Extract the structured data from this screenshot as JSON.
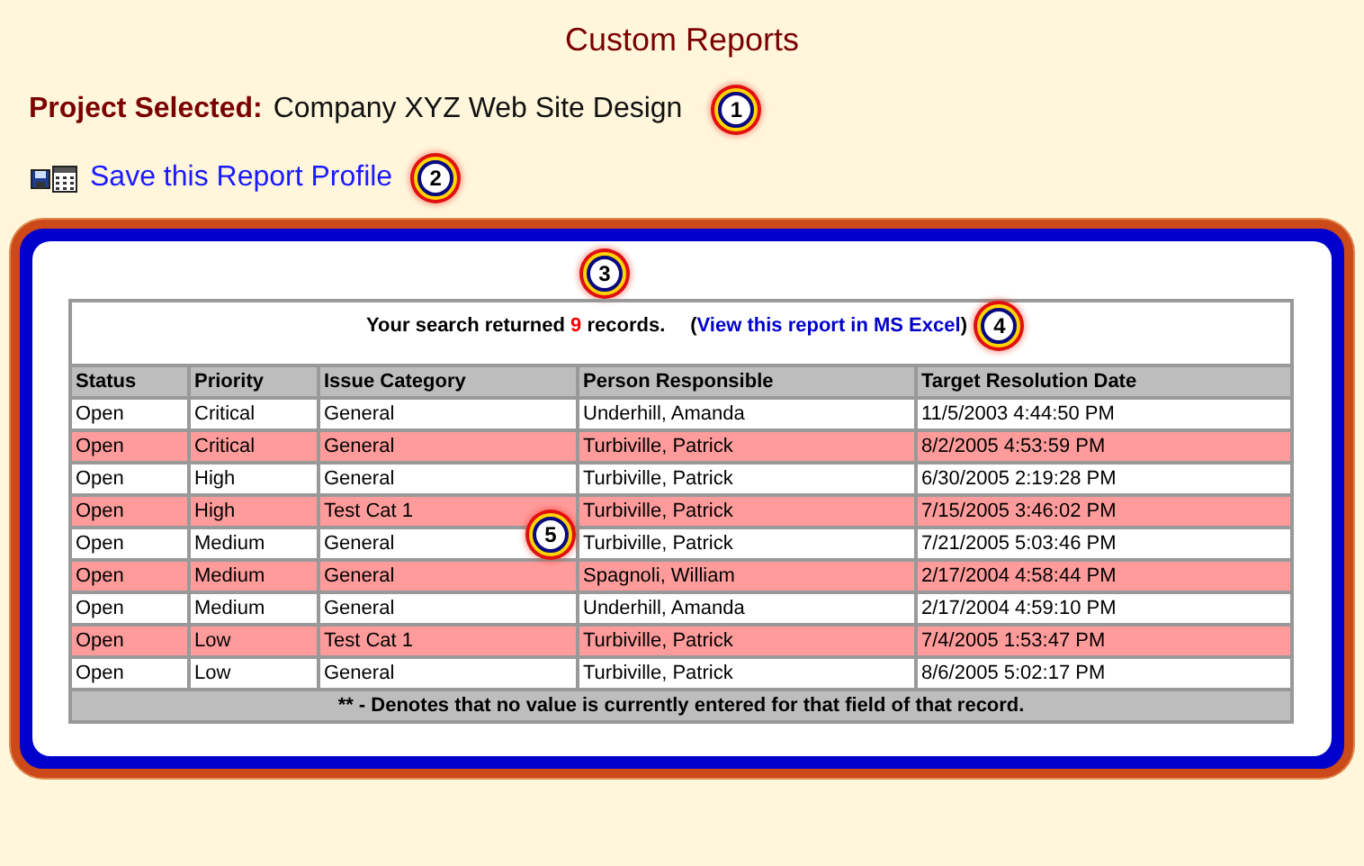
{
  "title": "Custom Reports",
  "project": {
    "label": "Project Selected:",
    "value": "Company XYZ Web Site Design",
    "callout": "1"
  },
  "save_link": {
    "text": "Save this Report Profile",
    "callout": "2"
  },
  "report": {
    "callout_above": "3",
    "summary": {
      "prefix": "Your search returned",
      "count": "9",
      "suffix": "records.",
      "link_open": "(",
      "link": "View this report in MS Excel",
      "link_close": ")",
      "callout": "4"
    },
    "table_callout": "5",
    "columns": [
      "Status",
      "Priority",
      "Issue Category",
      "Person Responsible",
      "Target Resolution Date"
    ],
    "rows": [
      {
        "cells": [
          "Open",
          "Critical",
          "General",
          "Underhill, Amanda",
          "11/5/2003 4:44:50 PM"
        ],
        "highlighted": false
      },
      {
        "cells": [
          "Open",
          "Critical",
          "General",
          "Turbiville, Patrick",
          "8/2/2005 4:53:59 PM"
        ],
        "highlighted": true
      },
      {
        "cells": [
          "Open",
          "High",
          "General",
          "Turbiville, Patrick",
          "6/30/2005 2:19:28 PM"
        ],
        "highlighted": false
      },
      {
        "cells": [
          "Open",
          "High",
          "Test Cat 1",
          "Turbiville, Patrick",
          "7/15/2005 3:46:02 PM"
        ],
        "highlighted": true
      },
      {
        "cells": [
          "Open",
          "Medium",
          "General",
          "Turbiville, Patrick",
          "7/21/2005 5:03:46 PM"
        ],
        "highlighted": false
      },
      {
        "cells": [
          "Open",
          "Medium",
          "General",
          "Spagnoli, William",
          "2/17/2004 4:58:44 PM"
        ],
        "highlighted": true
      },
      {
        "cells": [
          "Open",
          "Medium",
          "General",
          "Underhill, Amanda",
          "2/17/2004 4:59:10 PM"
        ],
        "highlighted": false
      },
      {
        "cells": [
          "Open",
          "Low",
          "Test Cat 1",
          "Turbiville, Patrick",
          "7/4/2005 1:53:47 PM"
        ],
        "highlighted": true
      },
      {
        "cells": [
          "Open",
          "Low",
          "General",
          "Turbiville, Patrick",
          "8/6/2005 5:02:17 PM"
        ],
        "highlighted": false
      }
    ],
    "footnote": "** - Denotes that no value is currently entered for that field of that record."
  }
}
